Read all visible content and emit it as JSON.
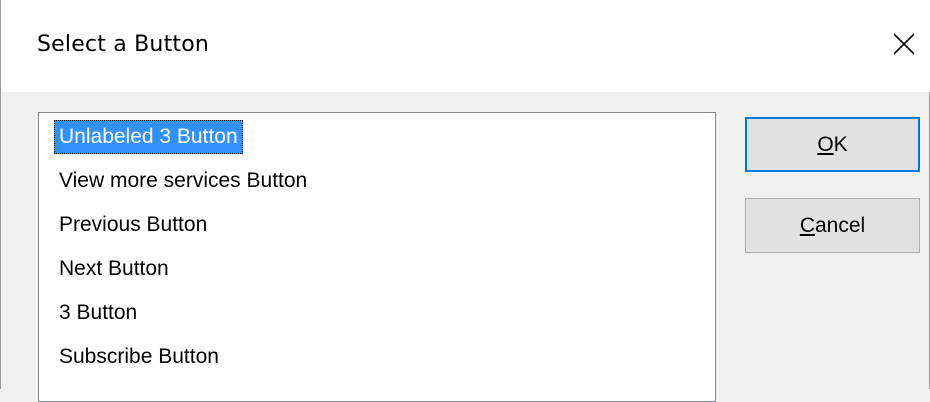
{
  "window": {
    "title": "Select a Button",
    "close_glyph": "✕"
  },
  "list": {
    "items": [
      {
        "label": "Unlabeled 3 Button",
        "selected": true
      },
      {
        "label": "View more services Button",
        "selected": false
      },
      {
        "label": "Previous Button",
        "selected": false
      },
      {
        "label": "Next Button",
        "selected": false
      },
      {
        "label": "3 Button",
        "selected": false
      },
      {
        "label": "Subscribe Button",
        "selected": false
      }
    ]
  },
  "buttons": {
    "ok": {
      "mnemonic": "O",
      "rest": "K"
    },
    "cancel": {
      "mnemonic": "C",
      "rest": "ancel"
    }
  },
  "colors": {
    "selection": "#3390ff",
    "default_button_border": "#0078d7",
    "button_face": "#e1e1e1",
    "dialog_bg": "#f0f0f0"
  },
  "icons": {
    "close": "close-icon"
  }
}
